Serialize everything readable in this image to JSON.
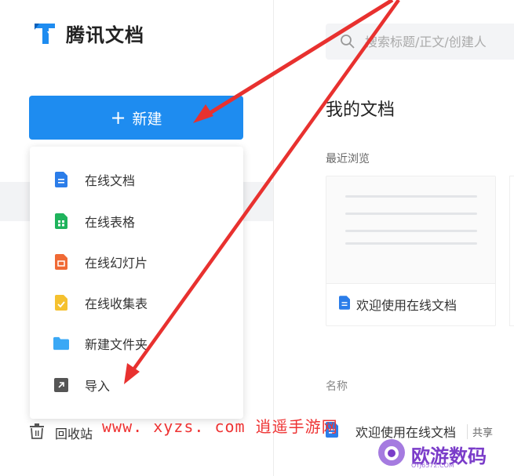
{
  "app": {
    "name": "腾讯文档"
  },
  "sidebar": {
    "new_button_label": "新建",
    "menu": [
      {
        "label": "在线文档",
        "icon": "doc-icon",
        "color": "#2b7de9"
      },
      {
        "label": "在线表格",
        "icon": "sheet-icon",
        "color": "#1fb35c"
      },
      {
        "label": "在线幻灯片",
        "icon": "slide-icon",
        "color": "#f06a35"
      },
      {
        "label": "在线收集表",
        "icon": "form-icon",
        "color": "#f5c12e"
      },
      {
        "label": "新建文件夹",
        "icon": "folder-icon",
        "color": "#3aa8f5"
      },
      {
        "label": "导入",
        "icon": "import-icon",
        "color": "#555555"
      }
    ],
    "trash_label": "回收站"
  },
  "main": {
    "search_placeholder": "搜索标题/正文/创建人",
    "heading": "我的文档",
    "recent_label": "最近浏览",
    "recent_card_title": "欢迎使用在线文档",
    "name_column": "名称",
    "rows": [
      {
        "title": "欢迎使用在线文档",
        "badge": "共享"
      }
    ]
  },
  "overlay": {
    "watermark_text": "www. xyzs. com  逍遥手游网",
    "site_logo_text": "欧游数码",
    "site_logo_sub": "OYJ6572.COM"
  },
  "colors": {
    "accent": "#1e8cf0",
    "arrow": "#e8312f"
  }
}
